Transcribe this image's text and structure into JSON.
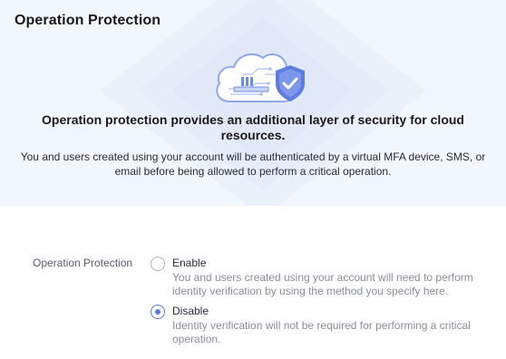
{
  "panel": {
    "title": "Operation Protection"
  },
  "banner": {
    "headline": "Operation protection provides an additional layer of security for cloud resources.",
    "description": "You and users created using your account will be authenticated by a virtual MFA device, SMS, or email before being allowed to perform a critical operation.",
    "illustration_icon": "cloud-shield-check-icon"
  },
  "form": {
    "field_label": "Operation Protection",
    "options": [
      {
        "label": "Enable",
        "hint": "You and users created using your account will need to perform identity verification by using the method you specify here.",
        "checked": false
      },
      {
        "label": "Disable",
        "hint": "Identity verification will not be required for performing a critical operation.",
        "checked": true
      }
    ]
  },
  "colors": {
    "accent": "#5e7ce0",
    "banner_bg": "#f2f6fd",
    "hint_text": "#8a8e99"
  }
}
